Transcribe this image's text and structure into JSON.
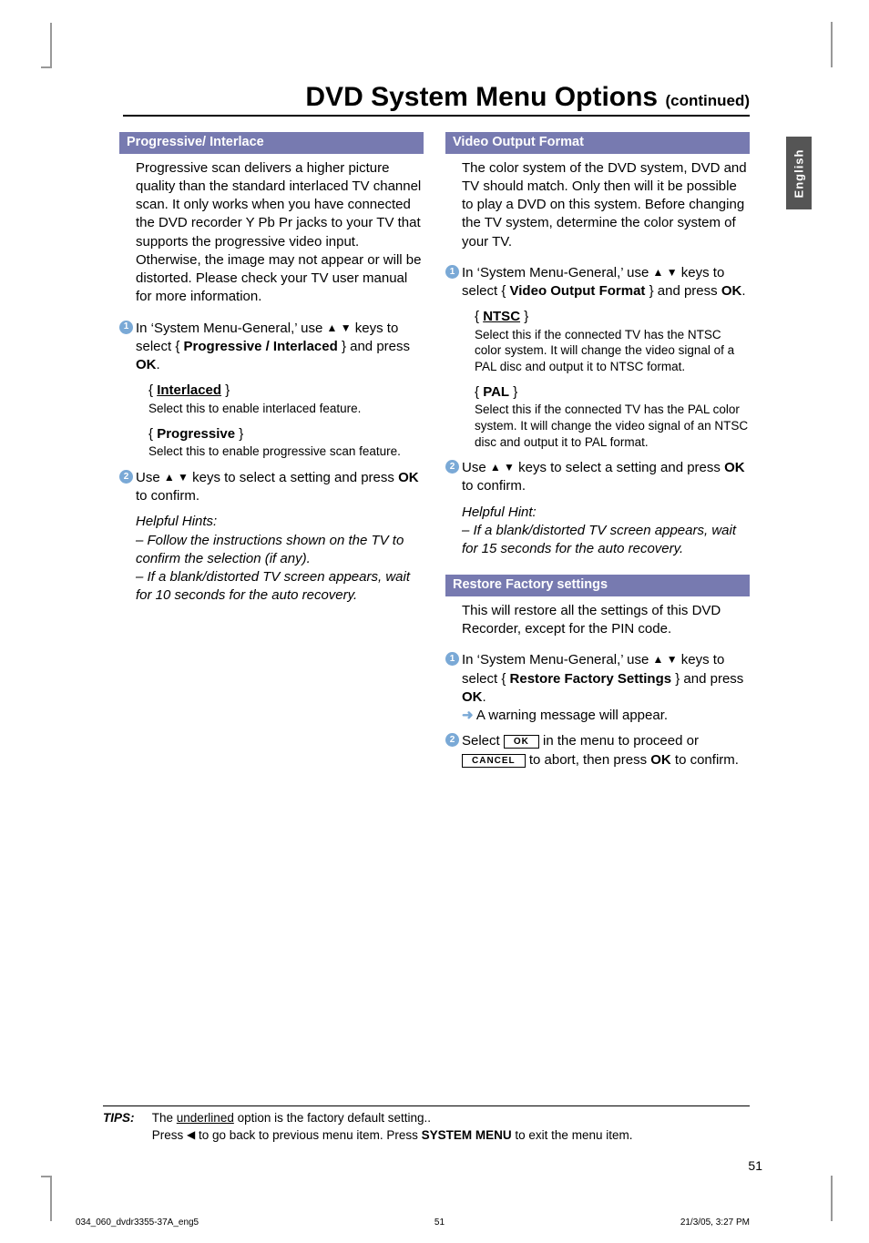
{
  "tab": "English",
  "title_main": "DVD System Menu Options ",
  "title_cont": "(continued)",
  "left": {
    "sect1_head": "Progressive/ Interlace",
    "sect1_body": "Progressive scan delivers a higher picture quality than the standard interlaced TV channel scan.  It only works when you have connected the DVD recorder Y Pb Pr jacks to your TV that supports the progressive video input. Otherwise, the image may not appear or will be distorted. Please check your TV user manual for more information.",
    "step1_pre": "In ‘System Menu-General,’ use ",
    "step1_keys": "▲ ▼",
    "step1_mid": " keys to select { ",
    "step1_opt": "Progressive / Interlaced",
    "step1_post": " } and press ",
    "step1_ok": "OK",
    "step1_end": ".",
    "opt1_lbl_open": "{ ",
    "opt1_lbl": "Interlaced",
    "opt1_lbl_close": " }",
    "opt1_desc": "Select this to enable interlaced feature.",
    "opt2_lbl_open": "{ ",
    "opt2_lbl": "Progressive",
    "opt2_lbl_close": " }",
    "opt2_desc": "Select this to enable progressive scan feature.",
    "step2_pre": "Use ",
    "step2_keys": "▲ ▼",
    "step2_mid": " keys to select a setting and press ",
    "step2_ok": "OK",
    "step2_post": " to confirm.",
    "hint_head": "Helpful Hints:",
    "hint1": "– Follow the instructions shown on the TV to confirm the selection (if any).",
    "hint2": "– If a blank/distorted TV screen appears, wait for 10 seconds for the auto recovery."
  },
  "right": {
    "sect1_head": "Video Output Format",
    "sect1_body": "The color system of the DVD system, DVD and TV should match. Only then will it be possible to play a DVD on this system.  Before changing the TV system, determine the color system of your TV.",
    "step1_pre": "In ‘System Menu-General,’ use ",
    "step1_keys": "▲ ▼",
    "step1_mid": " keys to select { ",
    "step1_opt": "Video Output Format",
    "step1_post": " } and press ",
    "step1_ok": "OK",
    "step1_end": ".",
    "opt1_lbl_open": "{ ",
    "opt1_lbl": "NTSC",
    "opt1_lbl_close": " }",
    "opt1_desc": "Select this if the connected TV has the NTSC color system. It will change the video signal of a PAL disc and output it to NTSC format.",
    "opt2_lbl_open": "{ ",
    "opt2_lbl": "PAL",
    "opt2_lbl_close": " }",
    "opt2_desc": "Select this if the connected TV has the PAL color system. It will change the video signal of an NTSC disc and output it to PAL format.",
    "step2_pre": "Use ",
    "step2_keys": "▲ ▼",
    "step2_mid": " keys to select a setting and press ",
    "step2_ok": "OK",
    "step2_post": " to confirm.",
    "hint_head": "Helpful Hint:",
    "hint1": "– If a blank/distorted TV screen appears, wait for 15 seconds for the auto recovery.",
    "sect2_head": "Restore Factory settings",
    "sect2_body": "This will restore all the settings of this DVD Recorder, except for the PIN code.",
    "s2_step1_pre": "In ‘System Menu-General,’ use ",
    "s2_step1_keys": "▲ ▼",
    "s2_step1_mid": " keys to select { ",
    "s2_step1_opt": "Restore Factory Settings",
    "s2_step1_post": " } and press ",
    "s2_step1_ok": "OK",
    "s2_step1_end": ".",
    "s2_arrow": "➜",
    "s2_warn": " A warning message will appear.",
    "s2_step2_pre": "Select ",
    "s2_btn_ok": "OK",
    "s2_step2_mid": " in the menu to proceed or ",
    "s2_btn_cancel": "CANCEL",
    "s2_step2_mid2": " to abort, then press ",
    "s2_ok": "OK",
    "s2_step2_post": " to confirm."
  },
  "tips_label": "TIPS:",
  "tips_line1_a": "The ",
  "tips_line1_u": "underlined",
  "tips_line1_b": " option is the factory default setting..",
  "tips_line2_a": "Press ",
  "tips_tri": "◀",
  "tips_line2_b": " to go back to previous menu item. Press ",
  "tips_sys": "SYSTEM MENU",
  "tips_line2_c": " to exit the menu item.",
  "pagenum": "51",
  "footer_left": "034_060_dvdr3355-37A_eng5",
  "footer_mid": "51",
  "footer_right": "21/3/05, 3:27 PM"
}
